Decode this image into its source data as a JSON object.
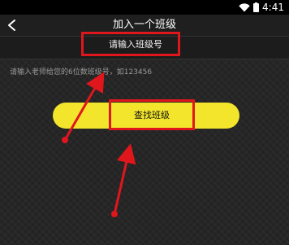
{
  "status_bar": {
    "time": "4:41",
    "icons": [
      "wifi-icon",
      "battery-icon"
    ]
  },
  "header": {
    "title": "加入一个班级",
    "back_icon": "back-arrow-icon"
  },
  "form": {
    "input_placeholder": "请输入班级号",
    "hint": "请输入老师给您的6位数班级号，如123456",
    "submit_label": "查找班级"
  },
  "colors": {
    "background": "#262626",
    "button": "#f3e52c",
    "highlight": "#e0161d"
  }
}
